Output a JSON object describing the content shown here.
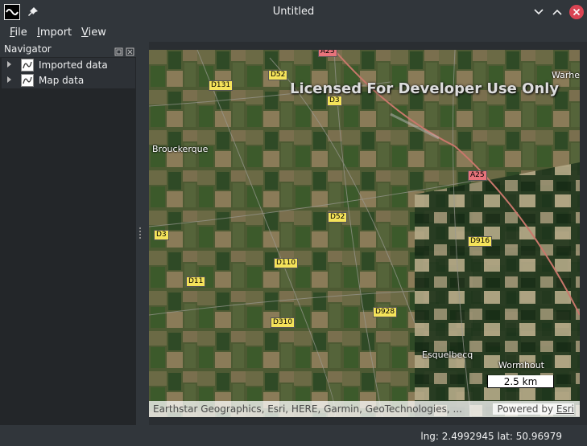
{
  "window": {
    "title": "Untitled"
  },
  "menu": {
    "file": {
      "accel": "F",
      "rest": "ile"
    },
    "import": {
      "accel": "I",
      "rest": "mport"
    },
    "view": {
      "accel": "V",
      "rest": "iew"
    }
  },
  "navigator": {
    "title": "Navigator",
    "items": [
      {
        "label": "Imported data"
      },
      {
        "label": "Map data"
      }
    ]
  },
  "map": {
    "watermark": "Licensed For Developer Use Only",
    "places": [
      "Brouckerque",
      "Esquelbecq",
      "Wormhout",
      "Warhe"
    ],
    "roads": [
      "D52",
      "D131",
      "D3",
      "D3",
      "A25",
      "D52",
      "D3",
      "D916",
      "D110",
      "D11",
      "D928",
      "D310"
    ],
    "scale": "2.5 km",
    "attribution": "Earthstar Geographics, Esri, HERE, Garmin, GeoTechnologies, ...",
    "powered_prefix": "Powered by ",
    "powered_brand": "Esri"
  },
  "status": {
    "text": "lng: 2.4992945 lat: 50.96979"
  },
  "colors": {
    "accent_close": "#da4453",
    "road_label": "#f5e35a",
    "motorway": "#e8737b"
  }
}
